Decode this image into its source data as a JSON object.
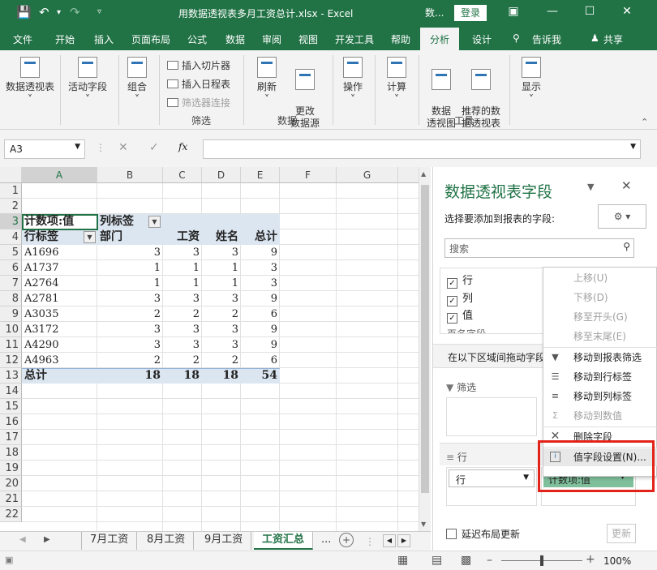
{
  "titlebar": {
    "title": "用数据透视表多月工资总计.xlsx  -  Excel",
    "account": "数...",
    "login": "登录",
    "buttons": [
      "save",
      "undo",
      "redo",
      "customize"
    ]
  },
  "menu": {
    "tabs": [
      "文件",
      "开始",
      "插入",
      "页面布局",
      "公式",
      "数据",
      "审阅",
      "视图",
      "开发工具",
      "帮助",
      "分析",
      "设计",
      "告诉我",
      "共享"
    ],
    "active": "分析"
  },
  "ribbon": {
    "pivot": "数据透视表",
    "active_field": "活动字段",
    "group": "组合",
    "insert_slicer": "插入切片器",
    "insert_timeline": "插入日程表",
    "filter_conn": "筛选器连接",
    "filter_group": "筛选",
    "refresh": "刷新",
    "change_source": "更改\n数据源",
    "data_group": "数据",
    "actions": "操作",
    "calculate": "计算",
    "pivot_chart": "数据\n透视图",
    "recommended": "推荐的数\n据透视表",
    "tools_group": "工具",
    "show": "显示"
  },
  "formula_bar": {
    "name_box": "A3",
    "fx": "fx",
    "content": ""
  },
  "sheet": {
    "columns": [
      "A",
      "B",
      "C",
      "D",
      "E",
      "F",
      "G"
    ],
    "rows": [
      "1",
      "2",
      "3",
      "4",
      "5",
      "6",
      "7",
      "8",
      "9",
      "10",
      "11",
      "12",
      "13",
      "14",
      "15",
      "16",
      "17",
      "18",
      "19",
      "20",
      "21",
      "22"
    ],
    "pivot": {
      "corner": "计数项:值",
      "col_label": "列标签",
      "row_label": "行标签",
      "headers": [
        "部门",
        "工资",
        "姓名",
        "总计"
      ],
      "data": [
        {
          "label": "A1696",
          "values": [
            "3",
            "3",
            "3",
            "9"
          ]
        },
        {
          "label": "A1737",
          "values": [
            "1",
            "1",
            "1",
            "3"
          ]
        },
        {
          "label": "A2764",
          "values": [
            "1",
            "1",
            "1",
            "3"
          ]
        },
        {
          "label": "A2781",
          "values": [
            "3",
            "3",
            "3",
            "9"
          ]
        },
        {
          "label": "A3035",
          "values": [
            "2",
            "2",
            "2",
            "6"
          ]
        },
        {
          "label": "A3172",
          "values": [
            "3",
            "3",
            "3",
            "9"
          ]
        },
        {
          "label": "A4290",
          "values": [
            "3",
            "3",
            "3",
            "9"
          ]
        },
        {
          "label": "A4963",
          "values": [
            "2",
            "2",
            "2",
            "6"
          ]
        }
      ],
      "total_label": "总计",
      "totals": [
        "18",
        "18",
        "18",
        "54"
      ]
    },
    "tabs": [
      "7月工资",
      "8月工资",
      "9月工资",
      "工资汇总",
      "..."
    ],
    "active_tab": "工资汇总"
  },
  "pane": {
    "title": "数据透视表字段",
    "subtitle": "选择要添加到报表的字段:",
    "search_placeholder": "搜索",
    "fields": [
      {
        "label": "行",
        "checked": "true"
      },
      {
        "label": "列",
        "checked": "true"
      },
      {
        "label": "值",
        "checked": "true"
      }
    ],
    "cut_field": "页名字段",
    "drag_hint": "在以下区域间拖动字段",
    "filter_area": "筛选",
    "row_area": "行",
    "row_item": "行",
    "value_item": "计数项:值",
    "defer": "延迟布局更新",
    "update": "更新"
  },
  "context_menu": {
    "items": [
      {
        "label": "上移(U)",
        "enabled": "false",
        "icon": "none"
      },
      {
        "label": "下移(D)",
        "enabled": "false",
        "icon": "none"
      },
      {
        "label": "移至开头(G)",
        "enabled": "false",
        "icon": "none"
      },
      {
        "label": "移至末尾(E)",
        "enabled": "false",
        "icon": "none"
      },
      {
        "label": "移动到报表筛选",
        "enabled": "true",
        "icon": "filter-icon"
      },
      {
        "label": "移动到行标签",
        "enabled": "true",
        "icon": "rows-icon"
      },
      {
        "label": "移动到列标签",
        "enabled": "true",
        "icon": "columns-icon"
      },
      {
        "label": "移动到数值",
        "enabled": "false",
        "icon": "sigma-icon"
      },
      {
        "label": "删除字段",
        "enabled": "true",
        "icon": "delete-icon"
      },
      {
        "label": "值字段设置(N)...",
        "enabled": "true",
        "icon": "settings-info-icon"
      }
    ]
  },
  "status": {
    "zoom": "100%"
  },
  "colors": {
    "brand": "#217346",
    "highlight": "#e2231a",
    "pivot_header": "#dce6f1",
    "pill": "#7fbf9b"
  }
}
